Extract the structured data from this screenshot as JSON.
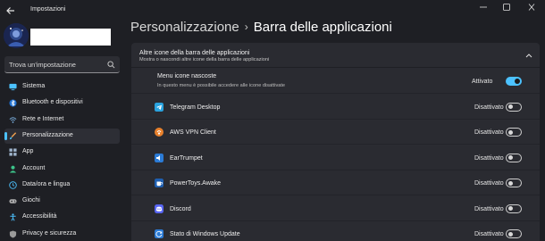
{
  "window": {
    "title": "Impostazioni"
  },
  "sidebar": {
    "search": {
      "placeholder": "Trova un'impostazione",
      "value": ""
    },
    "items": [
      {
        "label": "Sistema",
        "icon": "monitor-icon",
        "color": "#4cc2ff",
        "selected": false
      },
      {
        "label": "Bluetooth e dispositivi",
        "icon": "bluetooth-icon",
        "color": "#4cc2ff",
        "selected": false
      },
      {
        "label": "Rete e Internet",
        "icon": "network-icon",
        "color": "#7fb6e8",
        "selected": false
      },
      {
        "label": "Personalizzazione",
        "icon": "brush-icon",
        "color": "#f0a050",
        "selected": true
      },
      {
        "label": "App",
        "icon": "apps-icon",
        "color": "#9fb4cc",
        "selected": false
      },
      {
        "label": "Account",
        "icon": "account-icon",
        "color": "#3cc48a",
        "selected": false
      },
      {
        "label": "Data/ora e lingua",
        "icon": "globe-clock-icon",
        "color": "#4cc2ff",
        "selected": false
      },
      {
        "label": "Giochi",
        "icon": "gamepad-icon",
        "color": "#b0b0b0",
        "selected": false
      },
      {
        "label": "Accessibilità",
        "icon": "accessibility-icon",
        "color": "#4cc2ff",
        "selected": false
      },
      {
        "label": "Privacy e sicurezza",
        "icon": "shield-icon",
        "color": "#9a9a9a",
        "selected": false
      }
    ]
  },
  "breadcrumb": {
    "parent": "Personalizzazione",
    "separator": "›",
    "current": "Barra delle applicazioni"
  },
  "section": {
    "title": "Altre icone della barra delle applicazioni",
    "subtitle": "Mostra o nascondi altre icone della barra delle applicazioni"
  },
  "rows": [
    {
      "label": "Menu icone nascoste",
      "description": "In questo menu è possibile accedere alle icone disattivate",
      "state": "Attivato",
      "on": true,
      "icon": ""
    },
    {
      "label": "Telegram Desktop",
      "description": "",
      "state": "Disattivato",
      "on": false,
      "icon": "telegram-icon"
    },
    {
      "label": "AWS VPN Client",
      "description": "",
      "state": "Disattivato",
      "on": false,
      "icon": "aws-vpn-icon"
    },
    {
      "label": "EarTrumpet",
      "description": "",
      "state": "Disattivato",
      "on": false,
      "icon": "eartrumpet-icon"
    },
    {
      "label": "PowerToys.Awake",
      "description": "",
      "state": "Disattivato",
      "on": false,
      "icon": "powertoys-awake-icon"
    },
    {
      "label": "Discord",
      "description": "",
      "state": "Disattivato",
      "on": false,
      "icon": "discord-icon"
    },
    {
      "label": "Stato di Windows Update",
      "description": "",
      "state": "Disattivato",
      "on": false,
      "icon": "windows-update-icon"
    }
  ],
  "colors": {
    "accent": "#4cc2ff",
    "background": "#1e1f24",
    "panel": "#2a2b31"
  }
}
